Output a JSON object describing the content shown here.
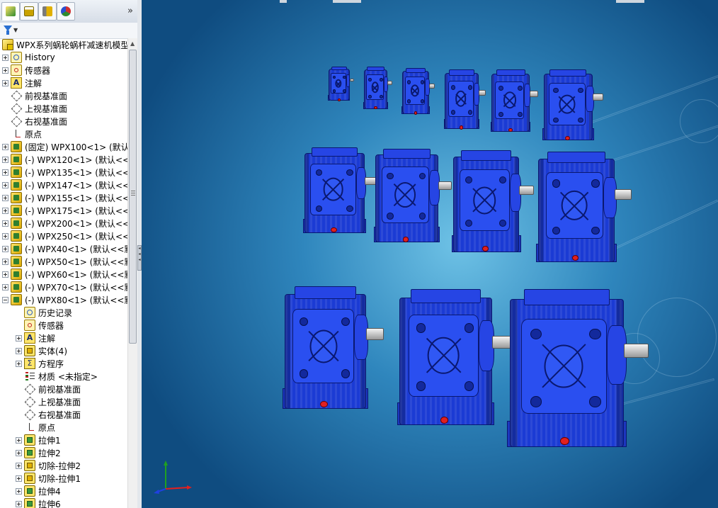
{
  "panel": {
    "tabs": [
      {
        "name": "featuremanager-tab",
        "icon": "feature-tree-icon",
        "color": "#2e8b2e",
        "active": true
      },
      {
        "name": "propertymanager-tab",
        "icon": "property-manager-icon",
        "color": "#c9a200"
      },
      {
        "name": "configurationmanager-tab",
        "icon": "configuration-icon",
        "color": "#7a7a7a"
      },
      {
        "name": "appearance-tab",
        "icon": "appearance-wheel-icon",
        "color": "#d03030"
      }
    ],
    "more_glyph": "»",
    "filter_arrow": "▼"
  },
  "tree": {
    "root": "WPX系列蜗轮蜗杆减速机模型",
    "items": [
      {
        "label": "History",
        "icon": "history-icon"
      },
      {
        "label": "传感器",
        "icon": "sensor-icon"
      },
      {
        "label": "注解",
        "icon": "annotation-icon",
        "glyph": "A"
      },
      {
        "label": "前视基准面",
        "icon": "plane-icon"
      },
      {
        "label": "上视基准面",
        "icon": "plane-icon"
      },
      {
        "label": "右视基准面",
        "icon": "plane-icon"
      },
      {
        "label": "原点",
        "icon": "origin-icon"
      },
      {
        "label": "(固定) WPX100<1> (默认",
        "icon": "part-icon"
      },
      {
        "label": "(-) WPX120<1> (默认<<",
        "icon": "part-icon"
      },
      {
        "label": "(-) WPX135<1> (默认<<",
        "icon": "part-icon"
      },
      {
        "label": "(-) WPX147<1> (默认<<",
        "icon": "part-icon"
      },
      {
        "label": "(-) WPX155<1> (默认<<",
        "icon": "part-icon"
      },
      {
        "label": "(-) WPX175<1> (默认<<",
        "icon": "part-icon"
      },
      {
        "label": "(-) WPX200<1> (默认<<",
        "icon": "part-icon"
      },
      {
        "label": "(-) WPX250<1> (默认<<",
        "icon": "part-icon"
      },
      {
        "label": "(-) WPX40<1> (默认<<默",
        "icon": "part-icon"
      },
      {
        "label": "(-) WPX50<1> (默认<<默",
        "icon": "part-icon"
      },
      {
        "label": "(-) WPX60<1> (默认<<默",
        "icon": "part-icon"
      },
      {
        "label": "(-) WPX70<1> (默认<<默",
        "icon": "part-icon"
      },
      {
        "label": "(-) WPX80<1> (默认<<默",
        "icon": "part-icon"
      },
      {
        "label": "历史记录",
        "icon": "history-icon"
      },
      {
        "label": "传感器",
        "icon": "sensor-icon"
      },
      {
        "label": "注解",
        "icon": "annotation-icon",
        "glyph": "A"
      },
      {
        "label": "实体(4)",
        "icon": "solid-bodies-icon"
      },
      {
        "label": "方程序",
        "icon": "equations-icon",
        "glyph": "Σ"
      },
      {
        "label": "材质 <未指定>",
        "icon": "material-icon"
      },
      {
        "label": "前视基准面",
        "icon": "plane-icon"
      },
      {
        "label": "上视基准面",
        "icon": "plane-icon"
      },
      {
        "label": "右视基准面",
        "icon": "plane-icon"
      },
      {
        "label": "原点",
        "icon": "origin-icon"
      },
      {
        "label": "拉伸1",
        "icon": "extrude-icon"
      },
      {
        "label": "拉伸2",
        "icon": "extrude-icon"
      },
      {
        "label": "切除-拉伸2",
        "icon": "cut-extrude-icon"
      },
      {
        "label": "切除-拉伸1",
        "icon": "cut-extrude-icon"
      },
      {
        "label": "拉伸4",
        "icon": "extrude-icon"
      },
      {
        "label": "拉伸6",
        "icon": "extrude-icon"
      }
    ]
  },
  "viewport": {
    "part_color": "#1b3bd4",
    "shaft_color": "#c8c8c8",
    "plug_color": "#e02020",
    "triad_colors": {
      "x": "#e02020",
      "y": "#20a020",
      "z": "#2040e0"
    }
  }
}
